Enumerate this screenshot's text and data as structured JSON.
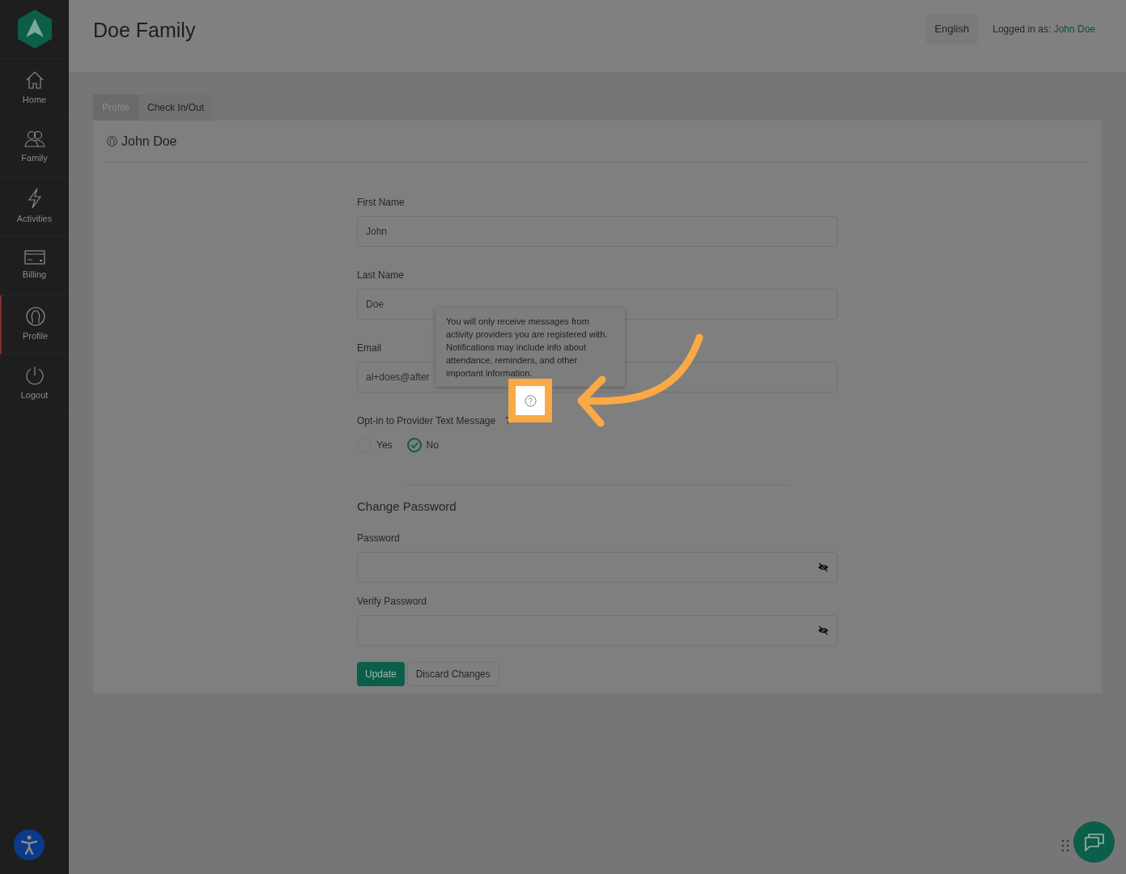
{
  "sidebar": {
    "items": [
      {
        "label": "Home",
        "selected": false
      },
      {
        "label": "Family",
        "selected": false
      },
      {
        "label": "Activities",
        "selected": false
      },
      {
        "label": "Billing",
        "selected": false
      },
      {
        "label": "Profile",
        "selected": true
      },
      {
        "label": "Logout",
        "selected": false
      }
    ]
  },
  "header": {
    "title": "Doe Family",
    "language": "English",
    "logged_in_label": "Logged in as:",
    "user_name": "John Doe"
  },
  "tabs": [
    {
      "label": "Profile",
      "selected": true
    },
    {
      "label": "Check In/Out",
      "selected": false
    }
  ],
  "profile": {
    "name": "John Doe",
    "fields": [
      {
        "label": "First Name",
        "value": "John"
      },
      {
        "label": "Last Name",
        "value": "Doe"
      },
      {
        "label": "Email",
        "value": "al+does@after"
      }
    ],
    "opt_in": {
      "label": "Opt-in to Provider Text Message",
      "question_mark": "?",
      "options": [
        {
          "label": "Yes",
          "selected": false
        },
        {
          "label": "No",
          "selected": true
        }
      ]
    },
    "tooltip": "You will only receive messages from activity providers you are registered with. Notifications may include info about attendance, reminders, and other important information.",
    "password_section": {
      "title": "Change Password",
      "fields": [
        {
          "label": "Password"
        },
        {
          "label": "Verify Password"
        }
      ]
    },
    "buttons": [
      {
        "label": "Update",
        "kind": "primary"
      },
      {
        "label": "Discard Changes",
        "kind": "secondary"
      }
    ]
  }
}
